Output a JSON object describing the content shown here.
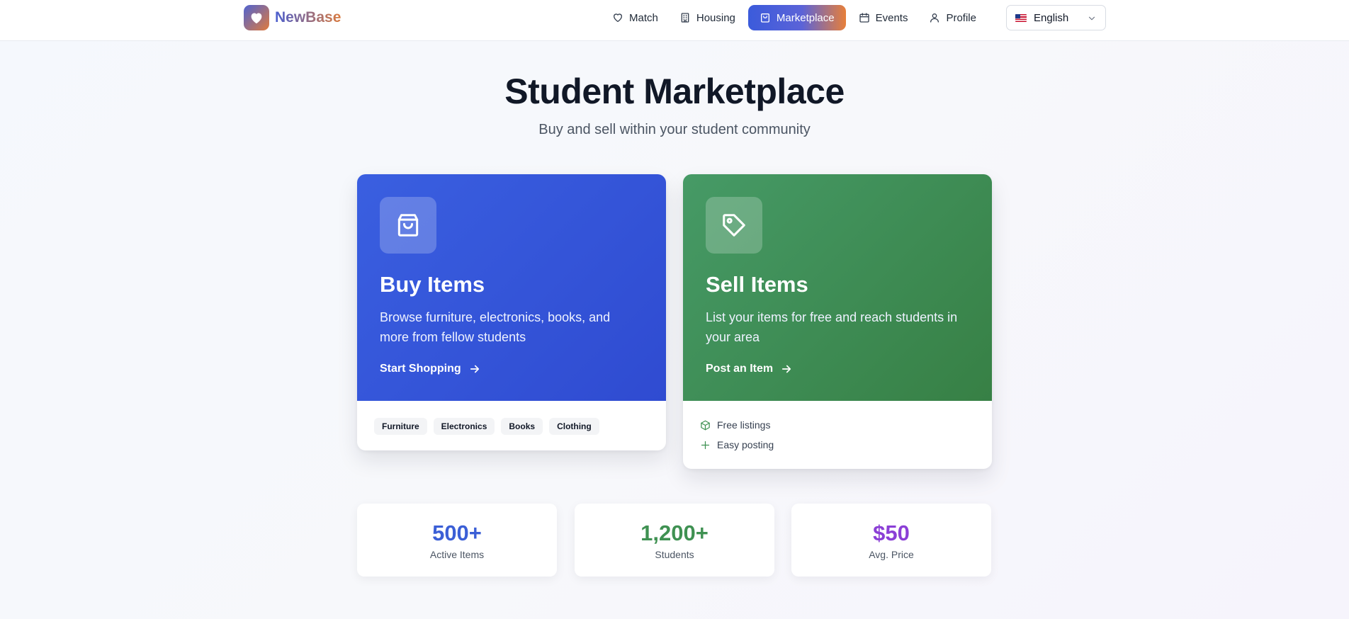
{
  "brand": {
    "name": "NewBase"
  },
  "nav": {
    "items": [
      {
        "label": "Match",
        "icon": "heart-icon"
      },
      {
        "label": "Housing",
        "icon": "building-icon"
      },
      {
        "label": "Marketplace",
        "icon": "shopping-bag-icon",
        "active": true
      },
      {
        "label": "Events",
        "icon": "calendar-icon"
      },
      {
        "label": "Profile",
        "icon": "user-icon"
      }
    ],
    "language": {
      "selected": "English",
      "flag": "us-flag-icon"
    }
  },
  "hero": {
    "title": "Student Marketplace",
    "subtitle": "Buy and sell within your student community"
  },
  "cards": {
    "buy": {
      "title": "Buy Items",
      "description": "Browse furniture, electronics, books, and more from fellow students",
      "cta": "Start Shopping",
      "tags": [
        "Furniture",
        "Electronics",
        "Books",
        "Clothing"
      ],
      "color": "#3358de"
    },
    "sell": {
      "title": "Sell Items",
      "description": "List your items for free and reach students in your area",
      "cta": "Post an Item",
      "features": [
        "Free listings",
        "Easy posting"
      ],
      "color": "#3f8a55"
    }
  },
  "stats": [
    {
      "value": "500+",
      "label": "Active Items",
      "color": "#3b5fd6"
    },
    {
      "value": "1,200+",
      "label": "Students",
      "color": "#3f9152"
    },
    {
      "value": "$50",
      "label": "Avg. Price",
      "color": "#8b3fd6"
    }
  ]
}
